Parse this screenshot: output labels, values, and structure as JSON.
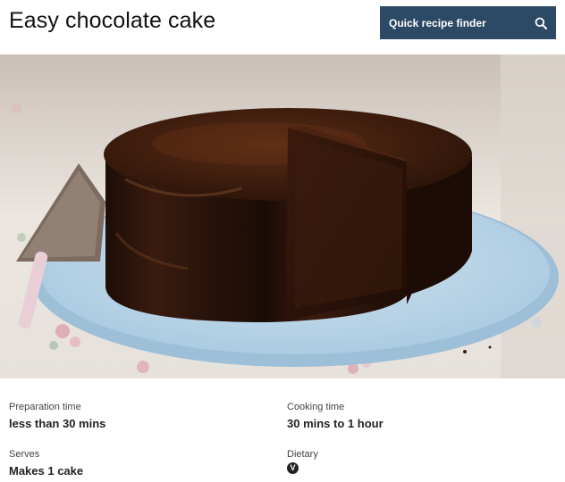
{
  "recipe": {
    "title": "Easy chocolate cake"
  },
  "finder": {
    "label": "Quick recipe finder",
    "icon": "search-icon",
    "background": "#2c4a66"
  },
  "hero": {
    "description_icon": "chocolate-cake-photo"
  },
  "details": {
    "prep_label": "Preparation time",
    "prep_value": "less than 30 mins",
    "cook_label": "Cooking time",
    "cook_value": "30 mins to 1 hour",
    "serves_label": "Serves",
    "serves_value": "Makes 1 cake",
    "dietary_label": "Dietary",
    "dietary_badge": "V"
  }
}
